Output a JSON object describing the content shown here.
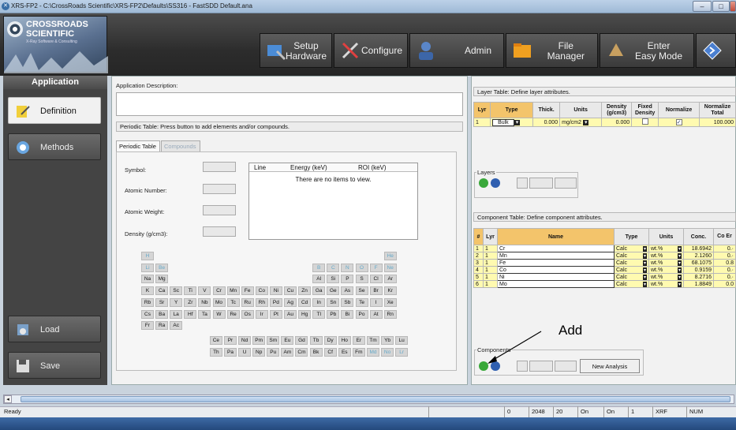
{
  "window": {
    "title": "XRS-FP2 - C:\\CrossRoads Scientific\\XRS-FP2\\Defaults\\SS316 - FastSDD Default.ana",
    "min_icon": "minimize-icon",
    "max_icon": "maximize-icon",
    "close_icon": "close-icon"
  },
  "logo": {
    "line1": "CROSSROADS",
    "line2": "SCIENTIFIC",
    "tagline": "X-Ray Software & Consulting"
  },
  "toolbar": {
    "setup": {
      "line1": "Setup",
      "line2": "Hardware"
    },
    "configure": "Configure",
    "admin": "Admin",
    "file": {
      "line1": "File",
      "line2": "Manager"
    },
    "easy": {
      "line1": "Enter",
      "line2": "Easy Mode"
    }
  },
  "nav": {
    "header": "Application",
    "definition": "Definition",
    "methods": "Methods",
    "load": "Load",
    "save": "Save"
  },
  "app_desc": {
    "label": "Application Description:",
    "value": ""
  },
  "periodic": {
    "section_label": "Periodic Table:  Press button to add elements and/or compounds.",
    "tabs": [
      "Periodic Table",
      "Compounds"
    ],
    "symbol_label": "Symbol:",
    "atomic_number_label": "Atomic Number:",
    "atomic_weight_label": "Atomic Weight:",
    "density_label": "Density (g/cm3):",
    "lines_headers": [
      "Line",
      "Energy (keV)",
      "ROI (keV)"
    ],
    "lines_empty": "There are no items to view."
  },
  "elements": {
    "r1": [
      "H",
      "He"
    ],
    "r2": [
      "Li",
      "Be",
      "B",
      "C",
      "N",
      "O",
      "F",
      "Ne"
    ],
    "r3": [
      "Na",
      "Mg",
      "Al",
      "Si",
      "P",
      "S",
      "Cl",
      "Ar"
    ],
    "r4": [
      "K",
      "Ca",
      "Sc",
      "Ti",
      "V",
      "Cr",
      "Mn",
      "Fe",
      "Co",
      "Ni",
      "Cu",
      "Zn",
      "Ga",
      "Ge",
      "As",
      "Se",
      "Br",
      "Kr"
    ],
    "r5": [
      "Rb",
      "Sr",
      "Y",
      "Zr",
      "Nb",
      "Mo",
      "Tc",
      "Ru",
      "Rh",
      "Pd",
      "Ag",
      "Cd",
      "In",
      "Sn",
      "Sb",
      "Te",
      "I",
      "Xe"
    ],
    "r6": [
      "Cs",
      "Ba",
      "La",
      "Hf",
      "Ta",
      "W",
      "Re",
      "Os",
      "Ir",
      "Pt",
      "Au",
      "Hg",
      "Tl",
      "Pb",
      "Bi",
      "Po",
      "At",
      "Rn"
    ],
    "r7": [
      "Fr",
      "Ra",
      "Ac"
    ],
    "lan": [
      "Ce",
      "Pr",
      "Nd",
      "Pm",
      "Sm",
      "Eu",
      "Gd",
      "Tb",
      "Dy",
      "Ho",
      "Er",
      "Tm",
      "Yb",
      "Lu"
    ],
    "act": [
      "Th",
      "Pa",
      "U",
      "Np",
      "Pu",
      "Am",
      "Cm",
      "Bk",
      "Cf",
      "Es",
      "Fm",
      "Md",
      "No",
      "Lr"
    ]
  },
  "layer_table": {
    "label": "Layer Table:  Define layer attributes.",
    "headers": [
      "Lyr",
      "Type",
      "Thick.",
      "Units",
      "Density (g/cm3)",
      "Fixed Density",
      "Normalize",
      "Normalize Total"
    ],
    "rows": [
      [
        "1",
        "Bulk",
        "0.000",
        "mg/cm2",
        "0.000",
        "",
        "",
        "100.000"
      ]
    ]
  },
  "layers_group": "Layers",
  "component_table": {
    "label": "Component Table:  Define component attributes.",
    "headers": [
      "#",
      "Lyr",
      "Name",
      "Type",
      "Units",
      "Conc.",
      "Co Er"
    ],
    "rows": [
      [
        "1",
        "1",
        "Cr",
        "Calc",
        "wt.%",
        "18.6942",
        "0.·"
      ],
      [
        "2",
        "1",
        "Mn",
        "Calc",
        "wt.%",
        "2.1260",
        "0.·"
      ],
      [
        "3",
        "1",
        "Fe",
        "Calc",
        "wt.%",
        "68.1075",
        "0.8"
      ],
      [
        "4",
        "1",
        "Co",
        "Calc",
        "wt.%",
        "0.9159",
        "0.·"
      ],
      [
        "5",
        "1",
        "Ni",
        "Calc",
        "wt.%",
        "8.2716",
        "0.·"
      ],
      [
        "6",
        "1",
        "Mo",
        "Calc",
        "wt.%",
        "1.8849",
        "0.0"
      ]
    ]
  },
  "components_group": "Components",
  "new_analysis": "New Analysis",
  "annotation": "Add",
  "status": {
    "ready": "Ready",
    "f1": "0",
    "f2": "2048",
    "f3": "20",
    "f4": "On",
    "f5": "On",
    "f6": "1",
    "f7": "XRF",
    "f8": "NUM"
  },
  "colors": {
    "accent_row": "#fffab0",
    "header_orange": "#f3c46b",
    "toolbar": "#333333"
  }
}
